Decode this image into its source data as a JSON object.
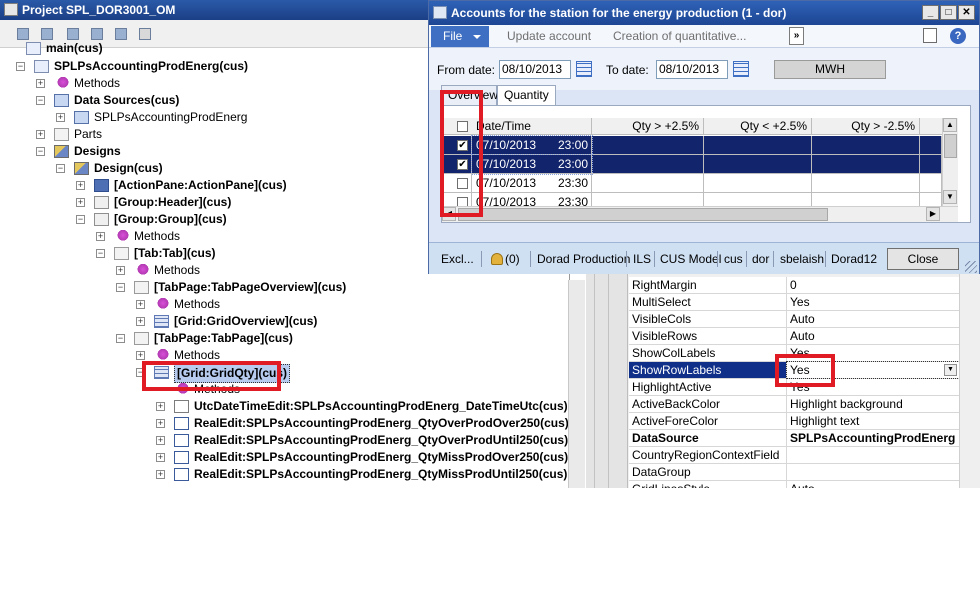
{
  "project": {
    "title": "Project SPL_DOR3001_OM",
    "tree": [
      {
        "label": "main(cus)",
        "icon": "node"
      },
      {
        "label": "SPLPsAccountingProdEnerg(cus)",
        "icon": "form"
      },
      {
        "label": "Methods",
        "icon": "methods"
      },
      {
        "label": "Data Sources(cus)",
        "icon": "datasrc"
      },
      {
        "label": "SPLPsAccountingProdEnerg",
        "icon": "datasrc"
      },
      {
        "label": "Parts",
        "icon": "folder"
      },
      {
        "label": "Designs",
        "icon": "design"
      },
      {
        "label": "Design(cus)",
        "icon": "design"
      },
      {
        "label": "[ActionPane:ActionPane](cus)",
        "icon": "action"
      },
      {
        "label": "[Group:Header](cus)",
        "icon": "group"
      },
      {
        "label": "[Group:Group](cus)",
        "icon": "group"
      },
      {
        "label": "Methods",
        "icon": "methods"
      },
      {
        "label": "[Tab:Tab](cus)",
        "icon": "folder"
      },
      {
        "label": "Methods",
        "icon": "methods"
      },
      {
        "label": "[TabPage:TabPageOverview](cus)",
        "icon": "folder"
      },
      {
        "label": "Methods",
        "icon": "methods"
      },
      {
        "label": "[Grid:GridOverview](cus)",
        "icon": "grid"
      },
      {
        "label": "[TabPage:TabPage](cus)",
        "icon": "folder"
      },
      {
        "label": "Methods",
        "icon": "methods"
      },
      {
        "label": "[Grid:GridQty](cus)",
        "icon": "grid"
      },
      {
        "label": "Methods",
        "icon": "methods"
      },
      {
        "label": "UtcDateTimeEdit:SPLPsAccountingProdEnerg_DateTimeUtc(cus)",
        "icon": "field"
      },
      {
        "label": "RealEdit:SPLPsAccountingProdEnerg_QtyOverProdOver250(cus)",
        "icon": "real"
      },
      {
        "label": "RealEdit:SPLPsAccountingProdEnerg_QtyOverProdUntil250(cus)",
        "icon": "real"
      },
      {
        "label": "RealEdit:SPLPsAccountingProdEnerg_QtyMissProdOver250(cus)",
        "icon": "real"
      },
      {
        "label": "RealEdit:SPLPsAccountingProdEnerg_QtyMissProdUntil250(cus)",
        "icon": "real"
      }
    ]
  },
  "properties": [
    {
      "name": "RightMargin",
      "value": "0"
    },
    {
      "name": "MultiSelect",
      "value": "Yes"
    },
    {
      "name": "VisibleCols",
      "value": "Auto"
    },
    {
      "name": "VisibleRows",
      "value": "Auto"
    },
    {
      "name": "ShowColLabels",
      "value": "Yes"
    },
    {
      "name": "ShowRowLabels",
      "value": "Yes"
    },
    {
      "name": "HighlightActive",
      "value": "Yes"
    },
    {
      "name": "ActiveBackColor",
      "value": "Highlight background"
    },
    {
      "name": "ActiveForeColor",
      "value": "Highlight text"
    },
    {
      "name": "DataSource",
      "value": "SPLPsAccountingProdEnerg"
    },
    {
      "name": "CountryRegionContextField",
      "value": ""
    },
    {
      "name": "DataGroup",
      "value": ""
    },
    {
      "name": "GridLinesStyle",
      "value": "Auto"
    }
  ],
  "dialog": {
    "title": "Accounts for the station for the energy production (1 - dor)",
    "menu": {
      "file": "File",
      "update": "Update account",
      "creation": "Creation of quantitative..."
    },
    "filter": {
      "from_label": "From date:",
      "from_value": "08/10/2013",
      "to_label": "To date:",
      "to_value": "08/10/2013",
      "unit": "MWH"
    },
    "tabs": {
      "overview": "Overview",
      "quantity": "Quantity"
    },
    "grid": {
      "columns": [
        "Date/Time",
        "Qty > +2.5%",
        "Qty < +2.5%",
        "Qty > -2.5%"
      ],
      "rows": [
        {
          "date": "07/10/2013",
          "time": "23:00",
          "checked": true,
          "selected": true
        },
        {
          "date": "07/10/2013",
          "time": "23:00",
          "checked": true,
          "selected": true
        },
        {
          "date": "07/10/2013",
          "time": "23:30",
          "checked": false,
          "selected": false
        },
        {
          "date": "07/10/2013",
          "time": "23:30",
          "checked": false,
          "selected": false
        }
      ]
    },
    "status": {
      "excel": "Excl...",
      "notifications": "(0)",
      "company": "Dorad Production",
      "ils": "ILS",
      "model": "CUS Model",
      "layer": "cus",
      "dataarea": "dor",
      "user": "sbelaish",
      "server": "Dorad12",
      "close": "Close"
    }
  },
  "colors": {
    "title_bar": "#1d4594",
    "selection": "#12246c",
    "highlight_box": "#e01b24"
  }
}
